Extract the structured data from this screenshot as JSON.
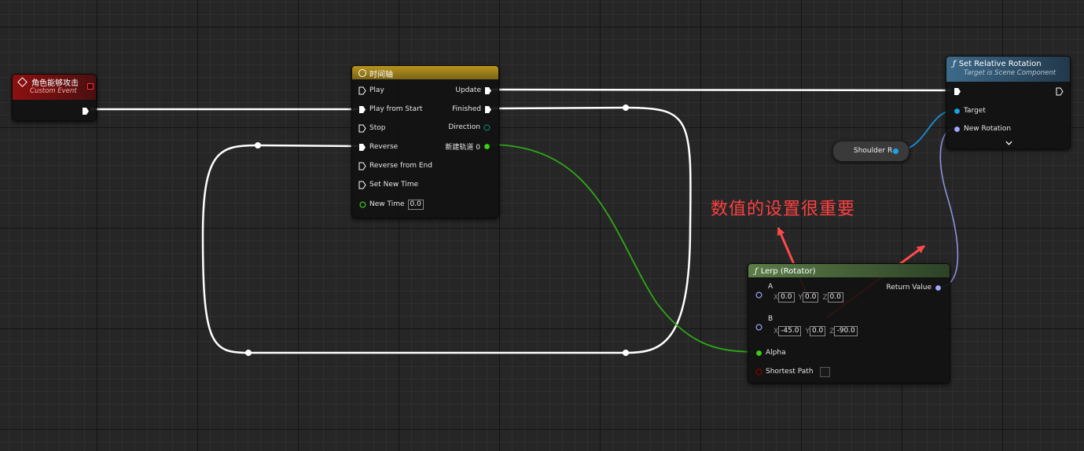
{
  "annotation": "数值的设置很重要",
  "custom_event": {
    "title": "角色能够攻击",
    "subtitle": "Custom Event"
  },
  "timeline": {
    "title": "时间轴",
    "inputs": [
      "Play",
      "Play from Start",
      "Stop",
      "Reverse",
      "Reverse from End",
      "Set New Time"
    ],
    "new_time_label": "New Time",
    "new_time_value": "0.0",
    "outputs": [
      "Update",
      "Finished",
      "Direction",
      "新建轨道 0"
    ]
  },
  "set_relative_rotation": {
    "title": "Set Relative Rotation",
    "subtitle": "Target is Scene Component",
    "target_label": "Target",
    "new_rotation_label": "New Rotation"
  },
  "shoulder_var": {
    "label": "Shoulder R"
  },
  "lerp": {
    "title": "Lerp (Rotator)",
    "a_label": "A",
    "a_values": {
      "x": "0.0",
      "y": "0.0",
      "z": "0.0"
    },
    "b_label": "B",
    "b_values": {
      "x": "-45.0",
      "y": "0.0",
      "z": "-90.0"
    },
    "alpha_label": "Alpha",
    "shortest_path_label": "Shortest Path",
    "return_label": "Return Value"
  },
  "axis_labels": {
    "x": "X",
    "y": "Y",
    "z": "Z"
  },
  "colors": {
    "exec_wire": "#ffffff",
    "float_pin": "#3ece1c",
    "rotator_pin": "#a0a8ff",
    "object_pin": "#1aa3e6",
    "bool_pin": "#930000",
    "event_header": "#8c1010",
    "timeline_header": "#a38111",
    "function_header_blue": "#3a5f78",
    "function_header_green": "#4a6d3c",
    "annotation": "#ff4040"
  }
}
